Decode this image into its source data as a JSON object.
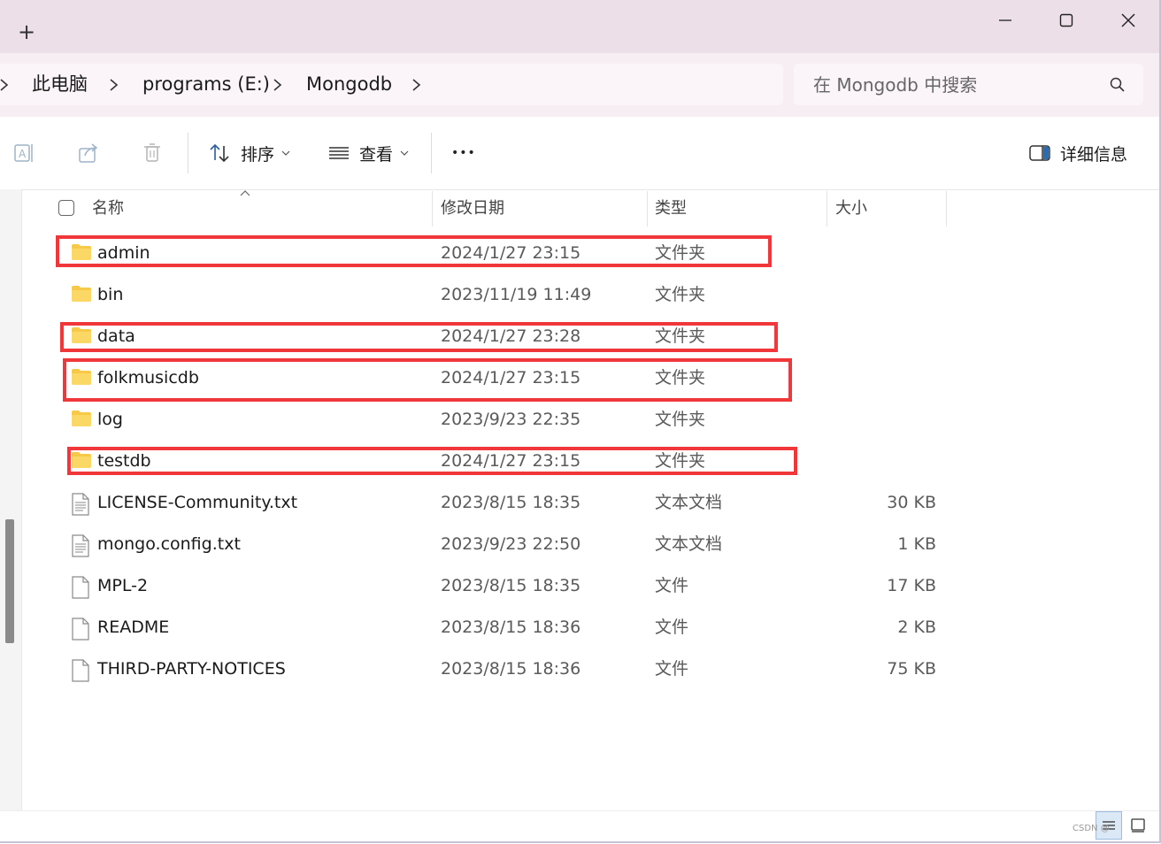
{
  "titlebar": {
    "new_tab_glyph": "+",
    "minimize_icon": "minimize-icon",
    "maximize_icon": "maximize-icon",
    "close_icon": "close-icon"
  },
  "breadcrumb": {
    "items": [
      "此电脑",
      "programs (E:)",
      "Mongodb"
    ]
  },
  "search": {
    "placeholder": "在 Mongodb 中搜索"
  },
  "toolbar": {
    "sort_label": "排序",
    "view_label": "查看",
    "more_label": "•••",
    "details_label": "详细信息"
  },
  "columns": {
    "name": "名称",
    "date": "修改日期",
    "type": "类型",
    "size": "大小"
  },
  "files": [
    {
      "name": "admin",
      "date": "2024/1/27 23:15",
      "type": "文件夹",
      "size": "",
      "kind": "folder"
    },
    {
      "name": "bin",
      "date": "2023/11/19 11:49",
      "type": "文件夹",
      "size": "",
      "kind": "folder"
    },
    {
      "name": "data",
      "date": "2024/1/27 23:28",
      "type": "文件夹",
      "size": "",
      "kind": "folder"
    },
    {
      "name": "folkmusicdb",
      "date": "2024/1/27 23:15",
      "type": "文件夹",
      "size": "",
      "kind": "folder"
    },
    {
      "name": "log",
      "date": "2023/9/23 22:35",
      "type": "文件夹",
      "size": "",
      "kind": "folder"
    },
    {
      "name": "testdb",
      "date": "2024/1/27 23:15",
      "type": "文件夹",
      "size": "",
      "kind": "folder"
    },
    {
      "name": "LICENSE-Community.txt",
      "date": "2023/8/15 18:35",
      "type": "文本文档",
      "size": "30 KB",
      "kind": "text"
    },
    {
      "name": "mongo.config.txt",
      "date": "2023/9/23 22:50",
      "type": "文本文档",
      "size": "1 KB",
      "kind": "text"
    },
    {
      "name": "MPL-2",
      "date": "2023/8/15 18:35",
      "type": "文件",
      "size": "17 KB",
      "kind": "file"
    },
    {
      "name": "README",
      "date": "2023/8/15 18:36",
      "type": "文件",
      "size": "2 KB",
      "kind": "file"
    },
    {
      "name": "THIRD-PARTY-NOTICES",
      "date": "2023/8/15 18:36",
      "type": "文件",
      "size": "75 KB",
      "kind": "file"
    }
  ],
  "highlighted_rows": [
    "admin",
    "data",
    "folkmusicdb",
    "testdb"
  ],
  "colors": {
    "highlight_border": "#f0373a",
    "titlebar_bg": "#ecdfe8",
    "folder_yellow": "#f7c948"
  },
  "watermark": "CSDN @"
}
